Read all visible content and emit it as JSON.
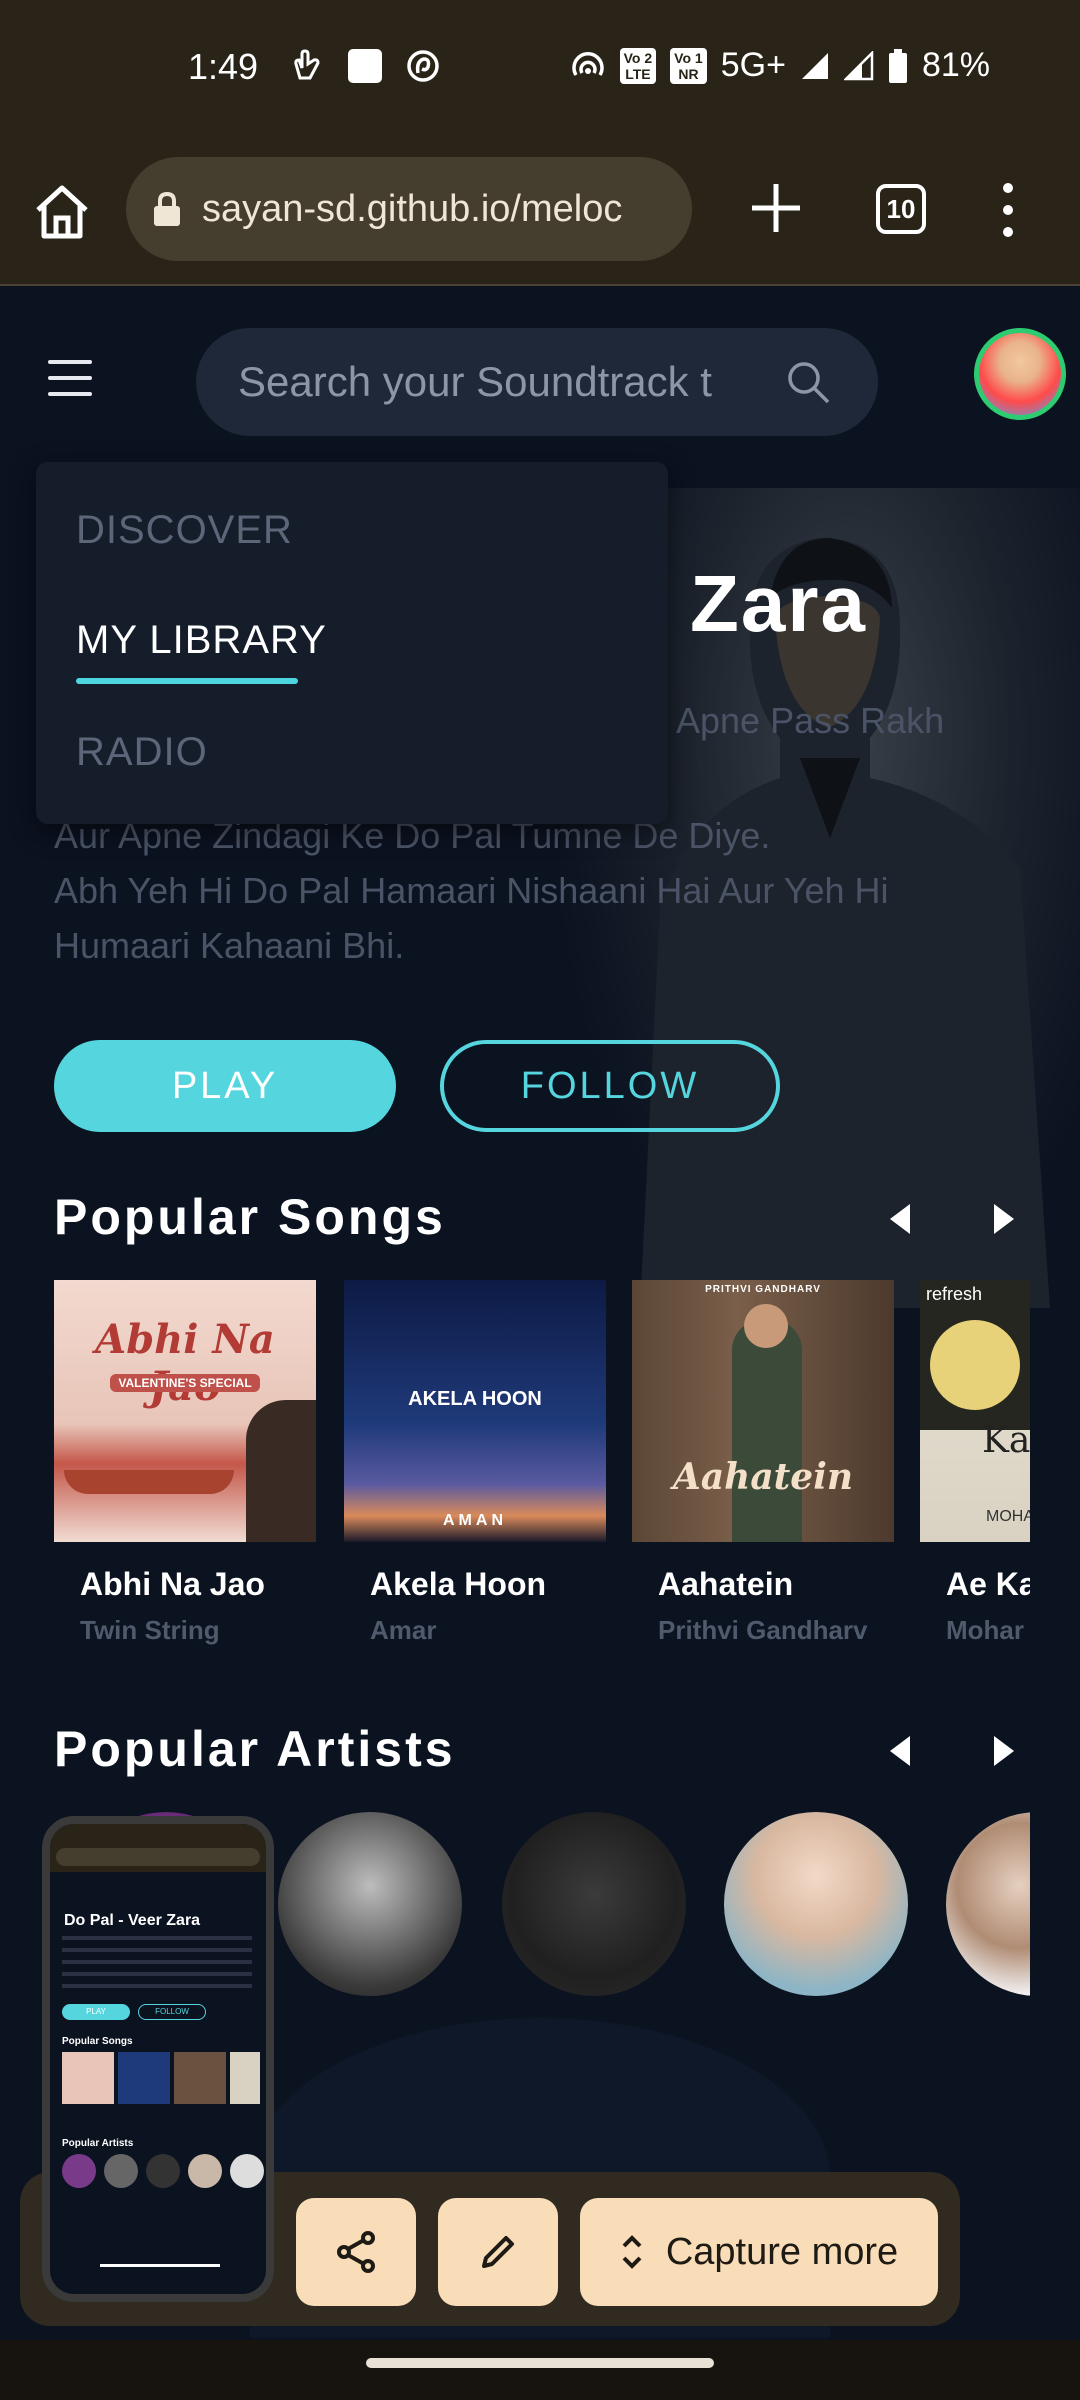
{
  "status_bar": {
    "time": "1:49",
    "network": "5G+",
    "battery": "81%",
    "volte_1": "Vo\nLTE",
    "volte_2": "Vo\nNR",
    "sim1": "2",
    "sim2": "1"
  },
  "browser": {
    "url": "sayan-sd.github.io/meloc",
    "tab_count": "10"
  },
  "header": {
    "search_placeholder": "Search your Soundtrack t"
  },
  "nav_menu": {
    "items": [
      {
        "label": "DISCOVER",
        "active": false
      },
      {
        "label": "MY LIBRARY",
        "active": true
      },
      {
        "label": "RADIO",
        "active": false
      }
    ]
  },
  "hero": {
    "title": "Zara",
    "line1": "Apne Pass Rakh",
    "desc_line2": "Aur Apne Zindagi Ke Do Pal Tumne De Diye.",
    "desc_line3": "Abh Yeh Hi Do Pal Hamaari Nishaani Hai Aur Yeh Hi",
    "desc_line4": "Humaari Kahaani Bhi.",
    "play_label": "PLAY",
    "follow_label": "FOLLOW"
  },
  "popular_songs": {
    "title": "Popular Songs",
    "items": [
      {
        "title": "Abhi Na Jao",
        "artist": "Twin String",
        "cover_text": "Abhi Na Jao",
        "cover_sub": "VALENTINE'S SPECIAL"
      },
      {
        "title": "Akela Hoon",
        "artist": "Amar",
        "cover_text": "AKELA HOON",
        "cover_sub": "AMAN"
      },
      {
        "title": "Aahatein",
        "artist": "Prithvi Gandharv",
        "cover_text": "Aahatein",
        "cover_sub": "PRITHVI GANDHARV"
      },
      {
        "title": "Ae Ka",
        "artist": "Mohar",
        "cover_text": "Ka",
        "cover_sub": "MOHA",
        "cover_brand": "refresh"
      }
    ]
  },
  "popular_artists": {
    "title": "Popular Artists"
  },
  "thumbnail": {
    "title": "Do Pal - Veer Zara",
    "play": "PLAY",
    "follow": "FOLLOW",
    "songs_heading": "Popular Songs",
    "artists_heading": "Popular Artists"
  },
  "capture_toolbar": {
    "capture_more_label": "Capture more"
  },
  "colors": {
    "accent": "#55d6df",
    "background": "#0b1220",
    "browser_chrome": "#2a2418",
    "toolbar_button": "#f8ddb8"
  }
}
